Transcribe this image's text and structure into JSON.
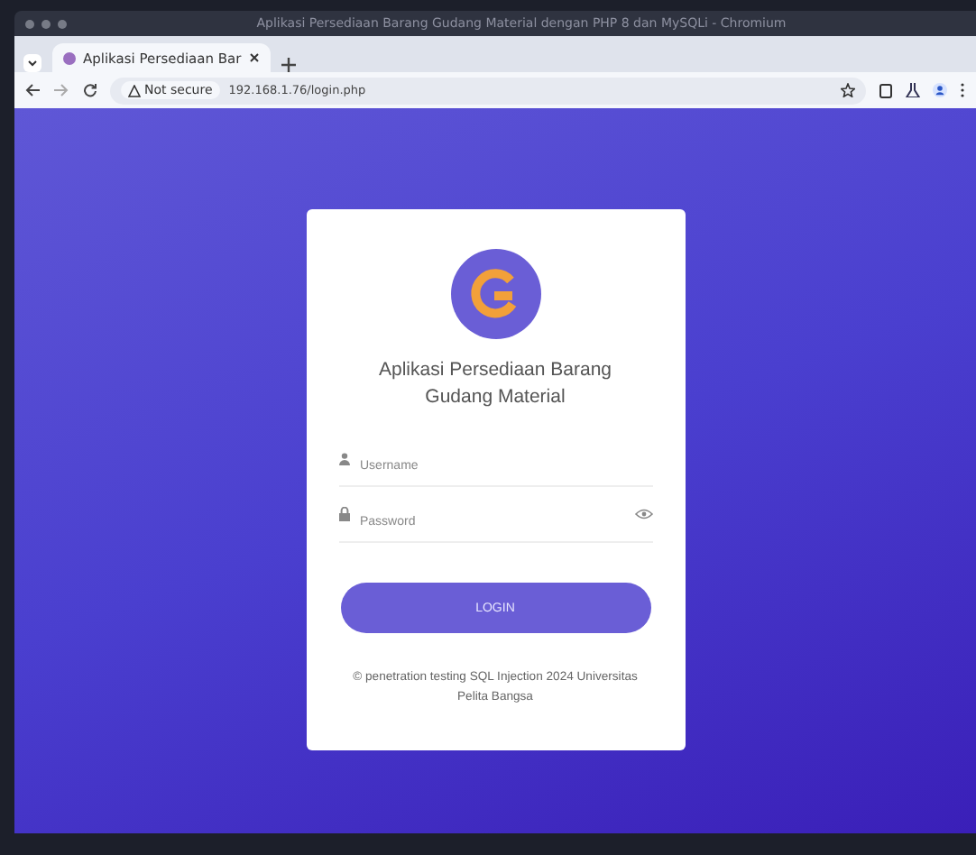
{
  "window": {
    "title": "Aplikasi Persediaan Barang Gudang Material dengan PHP 8 dan MySQLi - Chromium"
  },
  "tabs": [
    {
      "label": "Aplikasi Persediaan Bar",
      "selected": true
    }
  ],
  "address_bar": {
    "security": "Not secure",
    "url": "192.168.1.76/login.php"
  },
  "login": {
    "title": "Aplikasi Persediaan Barang Gudang Material",
    "fields": [
      {
        "kind": "text",
        "placeholder": "Username"
      },
      {
        "kind": "password",
        "placeholder": "Password"
      }
    ],
    "button": "LOGIN",
    "footer": "© penetration testing SQL Injection 2024 Universitas Pelita Bangsa"
  }
}
